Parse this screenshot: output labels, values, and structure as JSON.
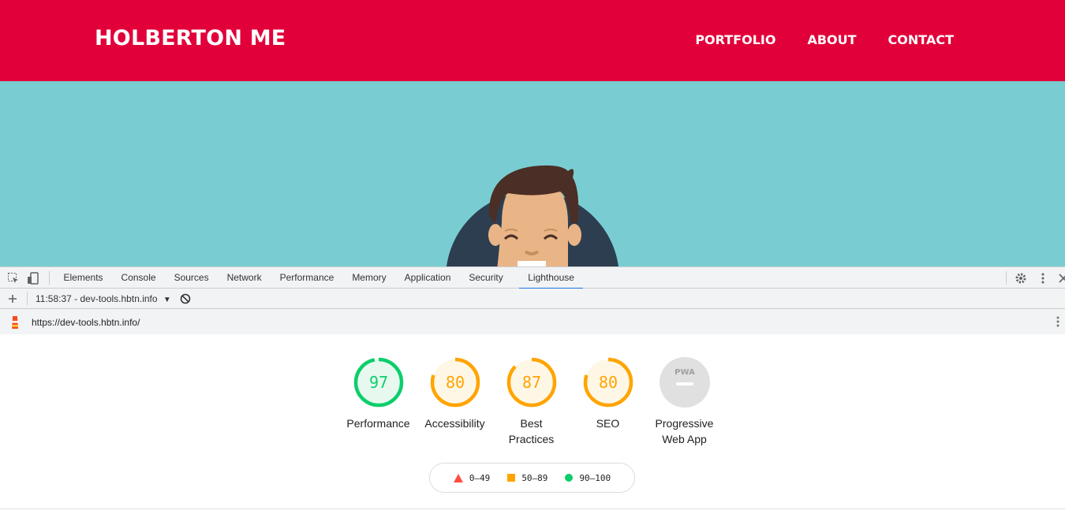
{
  "site": {
    "brand": "HOLBERTON ME",
    "nav": [
      "PORTFOLIO",
      "ABOUT",
      "CONTACT"
    ],
    "colors": {
      "header": "#e1003a",
      "hero": "#79cdd2"
    }
  },
  "devtools": {
    "tabs": [
      "Elements",
      "Console",
      "Sources",
      "Network",
      "Performance",
      "Memory",
      "Application",
      "Security",
      "Lighthouse"
    ],
    "active_tab": "Lighthouse",
    "toolbar_icons": [
      "inspect-element-icon",
      "device-toggle-icon",
      "settings-icon",
      "more-vert-icon",
      "close-icon"
    ],
    "run_label": "11:58:37 - dev-tools.hbtn.info",
    "url": "https://dev-tools.hbtn.info/"
  },
  "lighthouse": {
    "scores": [
      {
        "label": "Performance",
        "value": "97",
        "score": 97,
        "color": "#0cce6b",
        "bg": "#e7f9ef"
      },
      {
        "label": "Accessibility",
        "value": "80",
        "score": 80,
        "color": "#ffa400",
        "bg": "#fff7e6"
      },
      {
        "label": "Best Practices",
        "value": "87",
        "score": 87,
        "color": "#ffa400",
        "bg": "#fff7e6"
      },
      {
        "label": "SEO",
        "value": "80",
        "score": 80,
        "color": "#ffa400",
        "bg": "#fff7e6"
      }
    ],
    "pwa": {
      "label": "Progressive Web App",
      "badge": "PWA"
    },
    "legend": [
      {
        "range": "0–49",
        "color": "#ff4e42",
        "shape": "triangle"
      },
      {
        "range": "50–89",
        "color": "#ffa400",
        "shape": "square"
      },
      {
        "range": "90–100",
        "color": "#0cce6b",
        "shape": "circle"
      }
    ]
  }
}
